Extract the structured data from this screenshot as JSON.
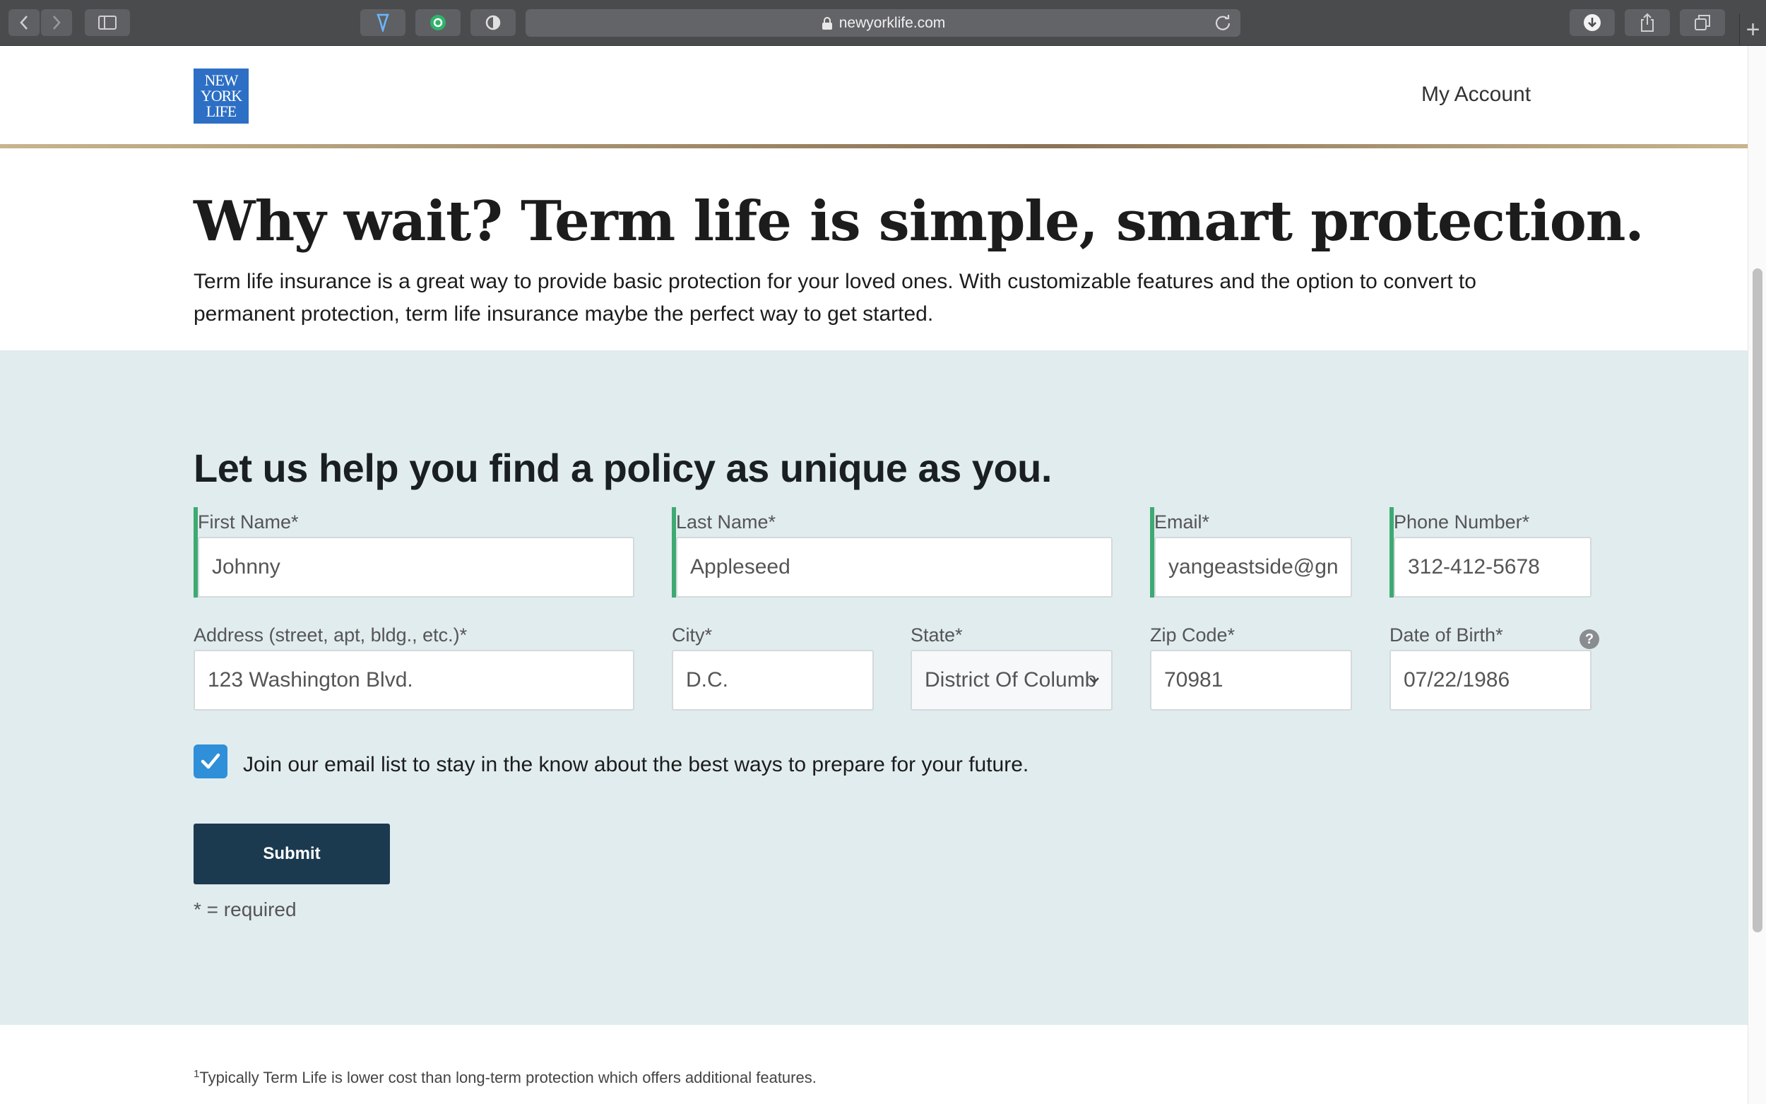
{
  "browser": {
    "url": "newyorklife.com"
  },
  "header": {
    "logo_lines": [
      "NEW",
      "YORK",
      "LIFE"
    ],
    "my_account": "My Account"
  },
  "hero": {
    "title": "Why wait? Term life is simple, smart protection.",
    "text": "Term life insurance is a great way to provide basic protection for your loved ones. With customizable features and the option to convert to permanent protection, term life insurance maybe the perfect way to get started."
  },
  "form": {
    "title": "Let us help you find a policy as unique as you.",
    "fields": {
      "first_name": {
        "label": "First Name*",
        "value": "Johnny"
      },
      "last_name": {
        "label": "Last Name*",
        "value": "Appleseed"
      },
      "email": {
        "label": "Email*",
        "value": "yangeastside@gn"
      },
      "phone": {
        "label": "Phone Number*",
        "value": "312-412-5678"
      },
      "address": {
        "label": "Address (street, apt, bldg., etc.)*",
        "value": "123 Washington Blvd."
      },
      "city": {
        "label": "City*",
        "value": "D.C."
      },
      "state": {
        "label": "State*",
        "value": "District Of Columb"
      },
      "zip": {
        "label": "Zip Code*",
        "value": "70981"
      },
      "dob": {
        "label": "Date of Birth*",
        "value": "07/22/1986"
      }
    },
    "help_symbol": "?",
    "email_list_label": "Join our email list to stay in the know about the best ways to prepare for your future.",
    "email_list_checked": true,
    "submit_label": "Submit",
    "required_note": "* = required"
  },
  "footnote": {
    "marker": "1",
    "text": "Typically Term Life is lower cost than long-term protection which offers additional features."
  },
  "colors": {
    "accent_green": "#3eaa72",
    "submit_bg": "#1b3a50",
    "form_bg": "#e1ecef",
    "checkbox_blue": "#2f8fd8",
    "logo_blue": "#2d6fc4"
  }
}
